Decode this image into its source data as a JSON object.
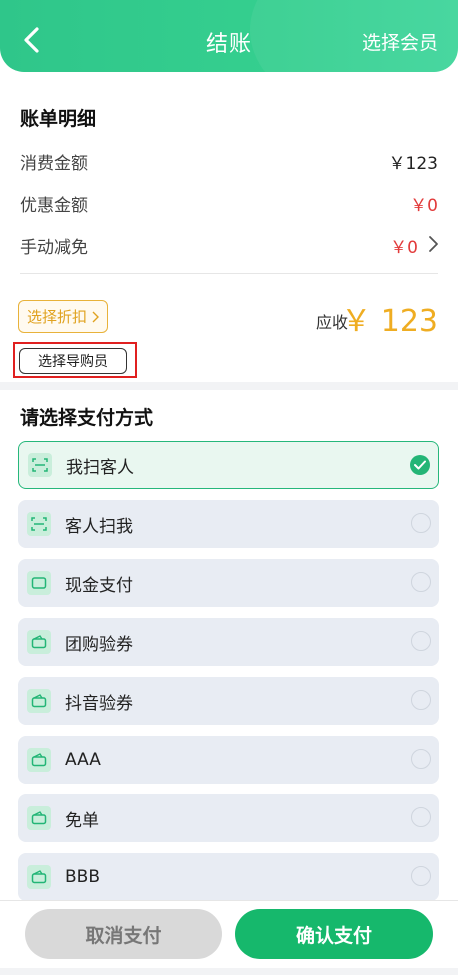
{
  "header": {
    "title": "结账",
    "select_member": "选择会员"
  },
  "bill": {
    "title": "账单明细",
    "rows": [
      {
        "label": "消费金额",
        "value": "￥123"
      },
      {
        "label": "优惠金额",
        "value": "￥0"
      },
      {
        "label": "手动减免",
        "value": "￥0"
      }
    ],
    "discount_button": "选择折扣",
    "receivable_label": "应收",
    "receivable_amount": "￥ 123",
    "guide_button": "选择导购员"
  },
  "payment": {
    "title": "请选择支付方式",
    "methods": [
      {
        "label": "我扫客人",
        "selected": true,
        "icon": "scan-icon"
      },
      {
        "label": "客人扫我",
        "selected": false,
        "icon": "scan-icon"
      },
      {
        "label": "现金支付",
        "selected": false,
        "icon": "cash-icon"
      },
      {
        "label": "团购验券",
        "selected": false,
        "icon": "wallet-icon"
      },
      {
        "label": "抖音验券",
        "selected": false,
        "icon": "wallet-icon"
      },
      {
        "label": "AAA",
        "selected": false,
        "icon": "wallet-icon"
      },
      {
        "label": "免单",
        "selected": false,
        "icon": "wallet-icon"
      },
      {
        "label": "BBB",
        "selected": false,
        "icon": "wallet-icon"
      }
    ]
  },
  "footer": {
    "cancel": "取消支付",
    "confirm": "确认支付"
  },
  "colors": {
    "brand_green": "#2fc68a",
    "confirm_green": "#16b86c",
    "accent_amber": "#efad22",
    "discount_red": "#e23b3b"
  }
}
